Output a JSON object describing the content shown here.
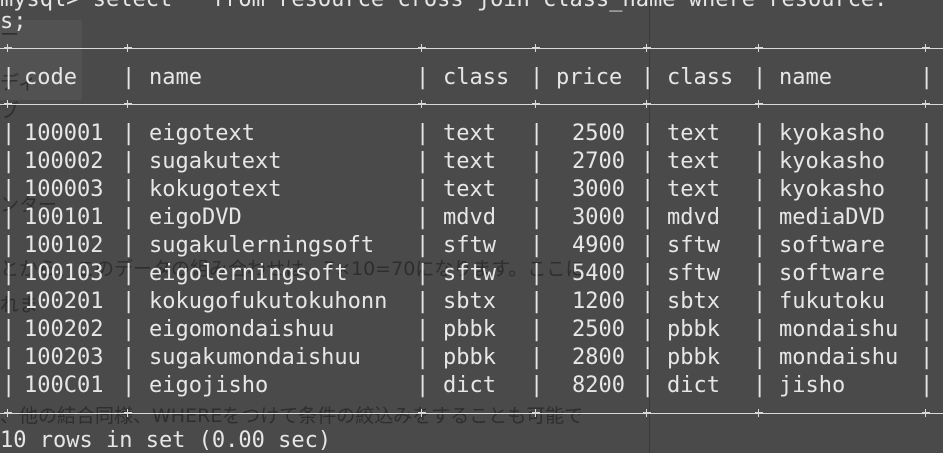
{
  "command_line": "mysql> select * from resource cross join class_name where resource.",
  "command_cont": "s;",
  "background_text": {
    "line1": "とから、このデータの組み合わせは、7×10=70になります。ここに",
    "line2": "れま",
    "line3": "、他の結合同様、WHEREをつけて条件の絞込みをすることも可能で",
    "side1": "ー",
    "side2": "ディ",
    "side3": "ブ",
    "side4": "ンター"
  },
  "table": {
    "headers": [
      "code",
      "name",
      "class",
      "price",
      "class",
      "name"
    ],
    "rows": [
      [
        "100001",
        "eigotext",
        "text",
        "2500",
        "text",
        "kyokasho"
      ],
      [
        "100002",
        "sugakutext",
        "text",
        "2700",
        "text",
        "kyokasho"
      ],
      [
        "100003",
        "kokugotext",
        "text",
        "3000",
        "text",
        "kyokasho"
      ],
      [
        "100101",
        "eigoDVD",
        "mdvd",
        "3000",
        "mdvd",
        "mediaDVD"
      ],
      [
        "100102",
        "sugakulerningsoft",
        "sftw",
        "4900",
        "sftw",
        "software"
      ],
      [
        "100103",
        "eigolerningsoft",
        "sftw",
        "5400",
        "sftw",
        "software"
      ],
      [
        "100201",
        "kokugofukutokuhonn",
        "sbtx",
        "1200",
        "sbtx",
        "fukutoku"
      ],
      [
        "100202",
        "eigomondaishuu",
        "pbbk",
        "2500",
        "pbbk",
        "mondaishu"
      ],
      [
        "100203",
        "sugakumondaishuu",
        "pbbk",
        "2800",
        "pbbk",
        "mondaishu"
      ],
      [
        "100C01",
        "eigojisho",
        "dict",
        "8200",
        "dict",
        "jisho"
      ]
    ]
  },
  "result_summary": "10 rows in set (0.00 sec)",
  "colors": {
    "terminal_bg": "#4a4a4a",
    "text": "#e6e6e6",
    "ghost_text": "#2e2e2e"
  }
}
